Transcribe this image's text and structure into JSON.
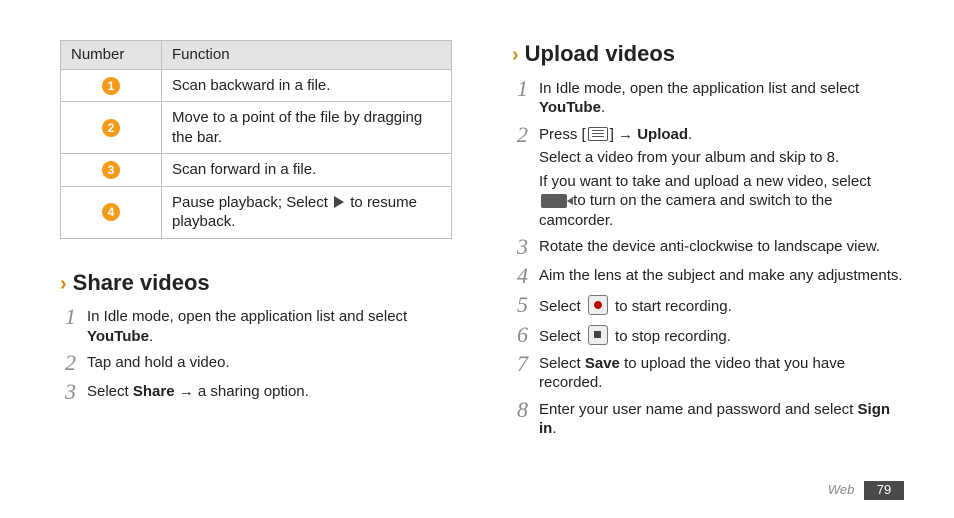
{
  "table": {
    "headers": {
      "col1": "Number",
      "col2": "Function"
    },
    "rows": {
      "r1": {
        "num": "1",
        "func": "Scan backward in a file."
      },
      "r2": {
        "num": "2",
        "func_a": "Move to a point of the file by dragging the bar."
      },
      "r3": {
        "num": "3",
        "func": "Scan forward in a file."
      },
      "r4": {
        "num": "4",
        "func_a": "Pause playback; Select ",
        "func_b": " to resume playback."
      }
    }
  },
  "share": {
    "title": "Share videos",
    "step1_a": "In Idle mode, open the application list and select ",
    "step1_b": "YouTube",
    "step1_c": ".",
    "step2": "Tap and hold a video.",
    "step3_a": "Select ",
    "step3_b": "Share",
    "step3_c": " → a sharing option."
  },
  "upload": {
    "title": "Upload videos",
    "step1_a": "In Idle mode, open the application list and select ",
    "step1_b": "YouTube",
    "step1_c": ".",
    "step2_a": "Press [",
    "step2_b": "] → ",
    "step2_c": "Upload",
    "step2_d": ".",
    "step2_e": "Select a video from your album and skip to 8.",
    "step2_f": "If you want to take and upload a new video, select ",
    "step2_g": " to turn on the camera and switch to the camcorder.",
    "step3": "Rotate the device anti-clockwise to landscape view.",
    "step4": "Aim the lens at the subject and make any adjustments.",
    "step5_a": "Select ",
    "step5_b": " to start recording.",
    "step6_a": "Select ",
    "step6_b": " to stop recording.",
    "step7_a": "Select ",
    "step7_b": "Save",
    "step7_c": " to upload the video that you have recorded.",
    "step8_a": "Enter your user name and password and select ",
    "step8_b": "Sign in",
    "step8_c": "."
  },
  "footer": {
    "category": "Web",
    "page": "79"
  }
}
